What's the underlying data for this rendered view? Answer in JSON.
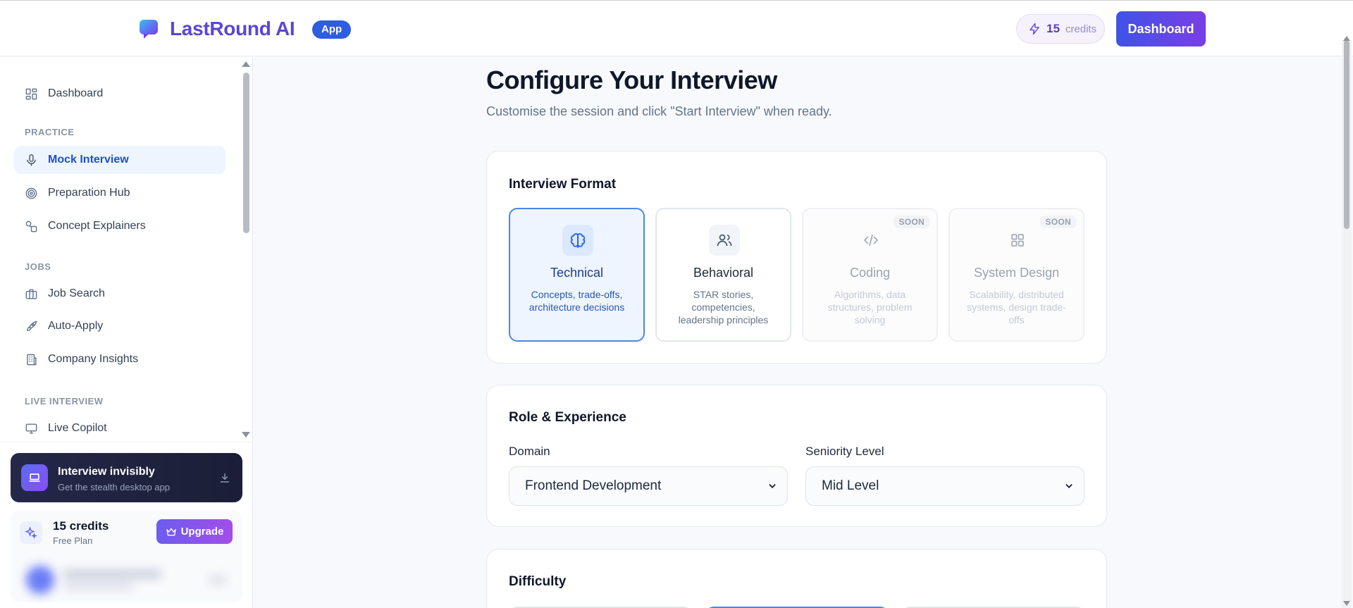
{
  "header": {
    "brand": "LastRound AI",
    "badge": "App",
    "credits_count": "15",
    "credits_label": "credits",
    "dashboard_button": "Dashboard"
  },
  "sidebar": {
    "dashboard": "Dashboard",
    "section_practice": "PRACTICE",
    "mock_interview": "Mock Interview",
    "preparation_hub": "Preparation Hub",
    "concept_explainers": "Concept Explainers",
    "section_jobs": "JOBS",
    "job_search": "Job Search",
    "auto_apply": "Auto-Apply",
    "company_insights": "Company Insights",
    "section_live": "LIVE INTERVIEW",
    "live_copilot": "Live Copilot",
    "promo_title": "Interview invisibly",
    "promo_subtitle": "Get the stealth desktop app",
    "plan_credits": "15 credits",
    "plan_name": "Free Plan",
    "upgrade_button": "Upgrade"
  },
  "main": {
    "title": "Configure Your Interview",
    "subtitle": "Customise the session and click \"Start Interview\" when ready.",
    "format": {
      "title": "Interview Format",
      "options": [
        {
          "name": "Technical",
          "desc": "Concepts, trade-offs, architecture decisions"
        },
        {
          "name": "Behavioral",
          "desc": "STAR stories, competencies, leadership principles"
        },
        {
          "name": "Coding",
          "desc": "Algorithms, data structures, problem solving",
          "badge": "SOON"
        },
        {
          "name": "System Design",
          "desc": "Scalability, distributed systems, design trade-offs",
          "badge": "SOON"
        }
      ]
    },
    "role": {
      "title": "Role & Experience",
      "domain_label": "Domain",
      "domain_value": "Frontend Development",
      "seniority_label": "Seniority Level",
      "seniority_value": "Mid Level"
    },
    "difficulty": {
      "title": "Difficulty"
    }
  },
  "colors": {
    "brand": "#5a45d8",
    "accent": "#2f5de0",
    "selected_border": "#4a86e8",
    "selected_bg": "#eef5ff"
  },
  "icons": {
    "logo": "chat-bubble-icon",
    "credits": "lightning-icon",
    "technical": "brain-icon",
    "behavioral": "users-icon",
    "coding": "code-icon",
    "system_design": "grid-icon"
  }
}
